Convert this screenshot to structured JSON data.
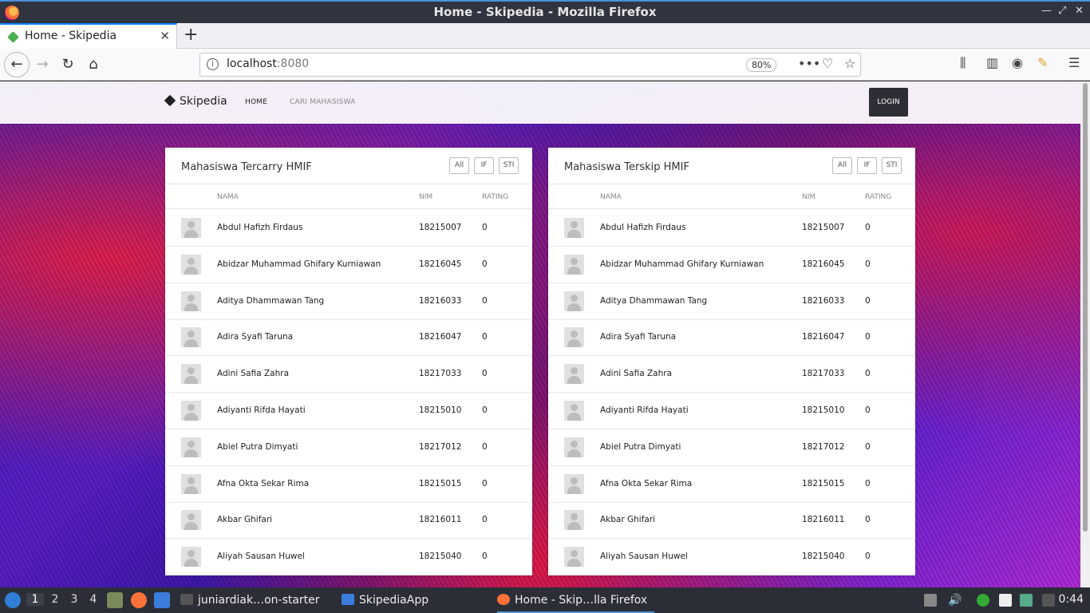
{
  "window": {
    "title": "Home - Skipedia - Mozilla Firefox"
  },
  "tabs": [
    {
      "label": "Home - Skipedia"
    }
  ],
  "urlbar": {
    "host": "localhost",
    "port": ":8080",
    "zoom": "80%"
  },
  "site": {
    "brand": "Skipedia",
    "nav": [
      "HOME",
      "CARI MAHASISWA"
    ],
    "login": "LOGIN"
  },
  "columns": {
    "name": "NAMA",
    "nim": "NIM",
    "rating": "RATING"
  },
  "filters": [
    "All",
    "IF",
    "STI"
  ],
  "cards": [
    {
      "title": "Mahasiswa Tercarry HMIF",
      "rows": [
        {
          "name": "Abdul Hafizh Firdaus",
          "nim": "18215007",
          "rating": "0"
        },
        {
          "name": "Abidzar Muhammad Ghifary Kurniawan",
          "nim": "18216045",
          "rating": "0"
        },
        {
          "name": "Aditya Dhammawan Tang",
          "nim": "18216033",
          "rating": "0"
        },
        {
          "name": "Adira Syafi Taruna",
          "nim": "18216047",
          "rating": "0"
        },
        {
          "name": "Adini Safia Zahra",
          "nim": "18217033",
          "rating": "0"
        },
        {
          "name": "Adiyanti Rifda Hayati",
          "nim": "18215010",
          "rating": "0"
        },
        {
          "name": "Abiel Putra Dimyati",
          "nim": "18217012",
          "rating": "0"
        },
        {
          "name": "Afna Okta Sekar Rima",
          "nim": "18215015",
          "rating": "0"
        },
        {
          "name": "Akbar Ghifari",
          "nim": "18216011",
          "rating": "0"
        },
        {
          "name": "Aliyah Sausan Huwel",
          "nim": "18215040",
          "rating": "0"
        }
      ]
    },
    {
      "title": "Mahasiswa Terskip HMIF",
      "rows": [
        {
          "name": "Abdul Hafizh Firdaus",
          "nim": "18215007",
          "rating": "0"
        },
        {
          "name": "Abidzar Muhammad Ghifary Kurniawan",
          "nim": "18216045",
          "rating": "0"
        },
        {
          "name": "Aditya Dhammawan Tang",
          "nim": "18216033",
          "rating": "0"
        },
        {
          "name": "Adira Syafi Taruna",
          "nim": "18216047",
          "rating": "0"
        },
        {
          "name": "Adini Safia Zahra",
          "nim": "18217033",
          "rating": "0"
        },
        {
          "name": "Adiyanti Rifda Hayati",
          "nim": "18215010",
          "rating": "0"
        },
        {
          "name": "Abiel Putra Dimyati",
          "nim": "18217012",
          "rating": "0"
        },
        {
          "name": "Afna Okta Sekar Rima",
          "nim": "18215015",
          "rating": "0"
        },
        {
          "name": "Akbar Ghifari",
          "nim": "18216011",
          "rating": "0"
        },
        {
          "name": "Aliyah Sausan Huwel",
          "nim": "18215040",
          "rating": "0"
        }
      ]
    }
  ],
  "taskbar": {
    "workspaces": [
      "1",
      "2",
      "3",
      "4"
    ],
    "tasks": [
      "juniardiak…on-starter",
      "SkipediaApp",
      "Home - Skip…lla Firefox"
    ],
    "clock": "0:44"
  },
  "icons": {
    "back": "back-arrow-icon",
    "forward": "forward-arrow-icon",
    "reload": "reload-icon",
    "home": "home-icon",
    "info": "info-icon",
    "more": "more-icon",
    "pocket": "pocket-icon",
    "bookmark": "star-icon",
    "library": "library-icon",
    "sidebar": "sidebar-icon",
    "account": "account-icon",
    "menu": "hamburger-icon"
  },
  "colors": {
    "accent": "#0a84ff",
    "login_bg": "#2d2d35",
    "taskbar_bg": "#2b2e37",
    "titlebar_bg": "#2f343f"
  }
}
